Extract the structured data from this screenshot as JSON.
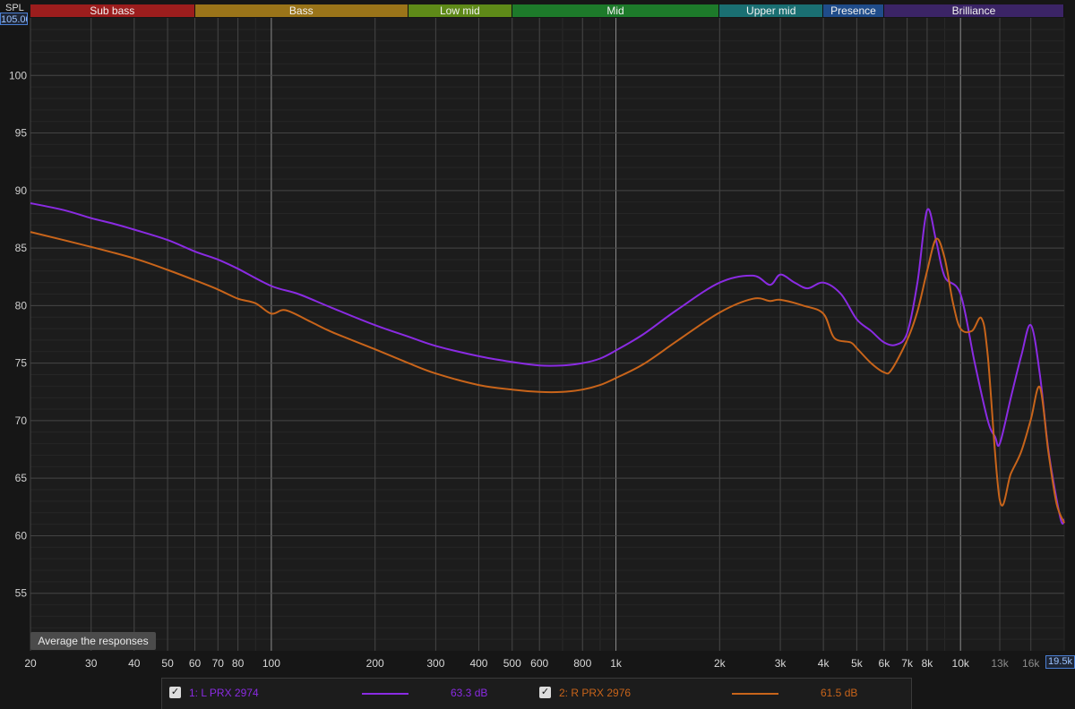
{
  "header": {
    "spl_label": "SPL",
    "ymax_value": "105.00",
    "xmax_value": "19.5k"
  },
  "bands": [
    {
      "name": "Sub bass",
      "from": 20,
      "to": 60,
      "color": "#9c1d1d"
    },
    {
      "name": "Bass",
      "from": 60,
      "to": 250,
      "color": "#9a7419"
    },
    {
      "name": "Low mid",
      "from": 250,
      "to": 500,
      "color": "#5e8a18"
    },
    {
      "name": "Mid",
      "from": 500,
      "to": 2000,
      "color": "#1d7a2a"
    },
    {
      "name": "Upper mid",
      "from": 2000,
      "to": 4000,
      "color": "#1a6f72"
    },
    {
      "name": "Presence",
      "from": 4000,
      "to": 6000,
      "color": "#1f4c8a"
    },
    {
      "name": "Brilliance",
      "from": 6000,
      "to": 20000,
      "color": "#3b2466"
    }
  ],
  "controls": {
    "average_button": "Average the responses"
  },
  "legend": [
    {
      "index": "1:",
      "name": "L PRX 2974",
      "level": "63.3 dB",
      "color": "#8a2be2",
      "checked": true
    },
    {
      "index": "2:",
      "name": "R PRX 2976",
      "level": "61.5 dB",
      "color": "#c8641a",
      "checked": true
    }
  ],
  "chart_data": {
    "type": "line",
    "xscale": "log",
    "xlim": [
      20,
      20000
    ],
    "ylim": [
      50,
      105
    ],
    "ylabel": "SPL",
    "grid": true,
    "yticks": [
      55,
      60,
      65,
      70,
      75,
      80,
      85,
      90,
      95,
      100
    ],
    "xticks": [
      {
        "value": 20,
        "label": "20"
      },
      {
        "value": 30,
        "label": "30"
      },
      {
        "value": 40,
        "label": "40"
      },
      {
        "value": 50,
        "label": "50"
      },
      {
        "value": 60,
        "label": "60"
      },
      {
        "value": 70,
        "label": "70"
      },
      {
        "value": 80,
        "label": "80"
      },
      {
        "value": 100,
        "label": "100"
      },
      {
        "value": 200,
        "label": "200"
      },
      {
        "value": 300,
        "label": "300"
      },
      {
        "value": 400,
        "label": "400"
      },
      {
        "value": 500,
        "label": "500"
      },
      {
        "value": 600,
        "label": "600"
      },
      {
        "value": 800,
        "label": "800"
      },
      {
        "value": 1000,
        "label": "1k"
      },
      {
        "value": 2000,
        "label": "2k"
      },
      {
        "value": 3000,
        "label": "3k"
      },
      {
        "value": 4000,
        "label": "4k"
      },
      {
        "value": 5000,
        "label": "5k"
      },
      {
        "value": 6000,
        "label": "6k"
      },
      {
        "value": 7000,
        "label": "7k"
      },
      {
        "value": 8000,
        "label": "8k"
      },
      {
        "value": 10000,
        "label": "10k"
      },
      {
        "value": 13000,
        "label": "13k"
      },
      {
        "value": 16000,
        "label": "16k"
      }
    ],
    "series": [
      {
        "name": "1: L PRX 2974",
        "color": "#8a2be2",
        "points": [
          [
            20,
            88.9
          ],
          [
            25,
            88.3
          ],
          [
            30,
            87.6
          ],
          [
            35,
            87.1
          ],
          [
            40,
            86.6
          ],
          [
            50,
            85.7
          ],
          [
            60,
            84.7
          ],
          [
            70,
            84
          ],
          [
            80,
            83.2
          ],
          [
            100,
            81.7
          ],
          [
            120,
            81
          ],
          [
            150,
            79.8
          ],
          [
            200,
            78.3
          ],
          [
            250,
            77.3
          ],
          [
            300,
            76.5
          ],
          [
            400,
            75.6
          ],
          [
            500,
            75.1
          ],
          [
            600,
            74.8
          ],
          [
            700,
            74.8
          ],
          [
            800,
            75
          ],
          [
            900,
            75.4
          ],
          [
            1000,
            76.1
          ],
          [
            1200,
            77.5
          ],
          [
            1500,
            79.6
          ],
          [
            2000,
            82
          ],
          [
            2500,
            82.6
          ],
          [
            2800,
            81.8
          ],
          [
            3000,
            82.7
          ],
          [
            3300,
            82
          ],
          [
            3600,
            81.5
          ],
          [
            4000,
            82
          ],
          [
            4500,
            81
          ],
          [
            5000,
            78.8
          ],
          [
            5500,
            77.8
          ],
          [
            6000,
            76.8
          ],
          [
            6500,
            76.6
          ],
          [
            7000,
            77.6
          ],
          [
            7500,
            82
          ],
          [
            8000,
            88.3
          ],
          [
            8500,
            85.6
          ],
          [
            9000,
            82.5
          ],
          [
            10000,
            81
          ],
          [
            11000,
            75
          ],
          [
            12000,
            70
          ],
          [
            12600,
            68.6
          ],
          [
            13000,
            68
          ],
          [
            14000,
            72
          ],
          [
            15000,
            75.6
          ],
          [
            16000,
            78.3
          ],
          [
            17000,
            74
          ],
          [
            18000,
            67.4
          ],
          [
            19500,
            61.5
          ],
          [
            20000,
            61.4
          ]
        ]
      },
      {
        "name": "2: R PRX 2976",
        "color": "#c8641a",
        "points": [
          [
            20,
            86.4
          ],
          [
            30,
            85.1
          ],
          [
            40,
            84.1
          ],
          [
            50,
            83.1
          ],
          [
            60,
            82.2
          ],
          [
            70,
            81.4
          ],
          [
            80,
            80.6
          ],
          [
            90,
            80.2
          ],
          [
            100,
            79.3
          ],
          [
            110,
            79.6
          ],
          [
            130,
            78.6
          ],
          [
            150,
            77.7
          ],
          [
            200,
            76.2
          ],
          [
            250,
            75
          ],
          [
            300,
            74.1
          ],
          [
            400,
            73.1
          ],
          [
            500,
            72.7
          ],
          [
            600,
            72.5
          ],
          [
            700,
            72.5
          ],
          [
            800,
            72.7
          ],
          [
            900,
            73.1
          ],
          [
            1000,
            73.7
          ],
          [
            1200,
            74.9
          ],
          [
            1500,
            76.9
          ],
          [
            2000,
            79.4
          ],
          [
            2500,
            80.6
          ],
          [
            2800,
            80.4
          ],
          [
            3000,
            80.5
          ],
          [
            3500,
            80
          ],
          [
            4000,
            79.3
          ],
          [
            4300,
            77.2
          ],
          [
            4800,
            76.8
          ],
          [
            5000,
            76.3
          ],
          [
            5500,
            75
          ],
          [
            6000,
            74.2
          ],
          [
            6300,
            74.4
          ],
          [
            7000,
            77
          ],
          [
            7500,
            79.5
          ],
          [
            8000,
            83
          ],
          [
            8500,
            85.8
          ],
          [
            9000,
            84.1
          ],
          [
            9500,
            80.3
          ],
          [
            10000,
            78
          ],
          [
            10800,
            77.8
          ],
          [
            11500,
            78.9
          ],
          [
            12000,
            75.6
          ],
          [
            13000,
            63.1
          ],
          [
            14000,
            65.4
          ],
          [
            15000,
            67.3
          ],
          [
            16000,
            70.1
          ],
          [
            17000,
            72.9
          ],
          [
            18000,
            67.2
          ],
          [
            19000,
            62.8
          ],
          [
            20000,
            61.1
          ]
        ]
      }
    ]
  }
}
